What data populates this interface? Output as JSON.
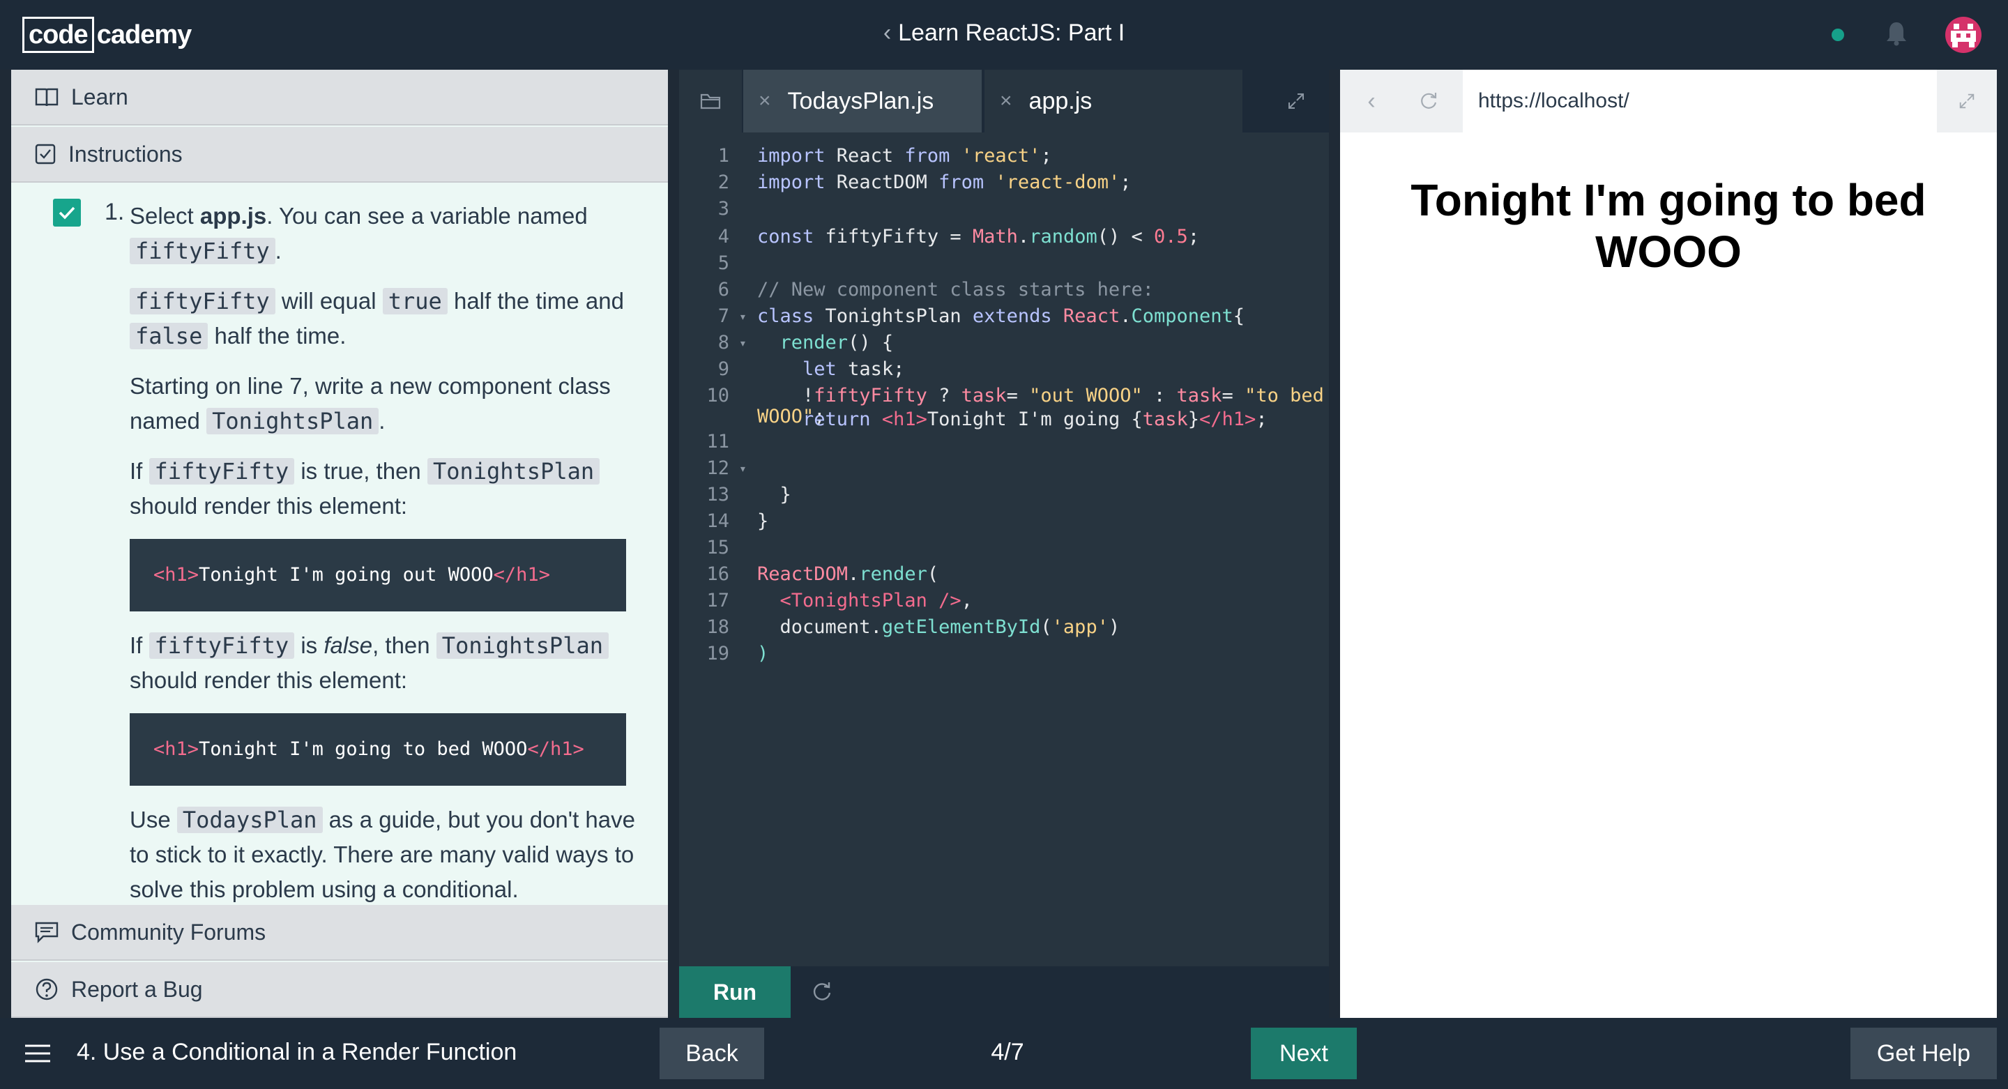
{
  "header": {
    "logo_box": "code",
    "logo_rest": "cademy",
    "course_title": "Learn ReactJS: Part I",
    "back_chevron": "‹"
  },
  "left_panel": {
    "learn_label": "Learn",
    "instructions_label": "Instructions",
    "community_label": "Community Forums",
    "bug_label": "Report a Bug",
    "step_number": "1.",
    "p1_a": "Select ",
    "p1_b": "app.js",
    "p1_c": ". You can see a variable named ",
    "p1_code": "fiftyFifty",
    "p1_d": ".",
    "p2_code1": "fiftyFifty",
    "p2_a": " will equal ",
    "p2_code2": "true",
    "p2_b": " half the time and ",
    "p2_code3": "false",
    "p2_c": " half the time.",
    "p3_a": "Starting on line 7, write a new component class named ",
    "p3_code": "TonightsPlan",
    "p3_b": ".",
    "p4_a": "If ",
    "p4_code1": "fiftyFifty",
    "p4_b": " is true, then ",
    "p4_code2": "TonightsPlan",
    "p4_c": " should render this element:",
    "code1_open": "<h1>",
    "code1_text": "Tonight I'm going out WOOO",
    "code1_close": "</h1>",
    "p5_a": "If ",
    "p5_code1": "fiftyFifty",
    "p5_b": " is ",
    "p5_em": "false",
    "p5_c": ", then ",
    "p5_code2": "TonightsPlan",
    "p5_d": " should render this element:",
    "code2_open": "<h1>",
    "code2_text": "Tonight I'm going to bed WOOO",
    "code2_close": "</h1>",
    "p6_a": "Use ",
    "p6_code": "TodaysPlan",
    "p6_b": " as a guide, but you don't have to stick to it exactly. There are many valid ways to solve this problem using a conditional."
  },
  "editor": {
    "tab1": "TodaysPlan.js",
    "tab2": "app.js",
    "tab_close": "×",
    "run_label": "Run",
    "line_numbers": [
      "1",
      "2",
      "3",
      "4",
      "5",
      "6",
      "7",
      "8",
      "9",
      "10",
      "11",
      "12",
      "13",
      "14",
      "15",
      "16",
      "17",
      "18",
      "19"
    ],
    "code": {
      "l1": [
        "import",
        " React ",
        "from",
        " ",
        "'react'",
        ";"
      ],
      "l2": [
        "import",
        " ReactDOM ",
        "from",
        " ",
        "'react-dom'",
        ";"
      ],
      "l4": [
        "const",
        " fiftyFifty ",
        "=",
        " ",
        "Math",
        ".",
        "random",
        "() ",
        "<",
        " ",
        "0.5",
        ";"
      ],
      "l6": "// New component class starts here:",
      "l7": [
        "class",
        " TonightsPlan ",
        "extends",
        " ",
        "React",
        ".",
        "Component",
        "{"
      ],
      "l8": [
        "  ",
        "render",
        "() {"
      ],
      "l9": [
        "    ",
        "let",
        " task;"
      ],
      "l10a": [
        "    !",
        "fiftyFifty",
        " ? ",
        "task",
        "= ",
        "\"out WOOO\"",
        " : ",
        "task",
        "= ",
        "\"to bed"
      ],
      "l10b": [
        "WOOO\"",
        ";"
      ],
      "l12": [
        "    ",
        "return",
        " ",
        "<h1>",
        "Tonight I'm going {",
        "task",
        "}",
        "</h1>",
        ";"
      ],
      "l13": "  }",
      "l14": "}",
      "l16": [
        "ReactDOM",
        ".",
        "render",
        "("
      ],
      "l17": [
        "  ",
        "<TonightsPlan />",
        ","
      ],
      "l18": [
        "  document",
        ".",
        "getElementById",
        "(",
        "'app'",
        ")"
      ],
      "l19": ")"
    }
  },
  "browser": {
    "url": "https://localhost/",
    "back": "‹",
    "output_heading": "Tonight I'm going to bed WOOO"
  },
  "footer": {
    "lesson_name": "4. Use a Conditional in a Render Function",
    "back_label": "Back",
    "progress": "4/7",
    "next_label": "Next",
    "help_label": "Get Help"
  }
}
